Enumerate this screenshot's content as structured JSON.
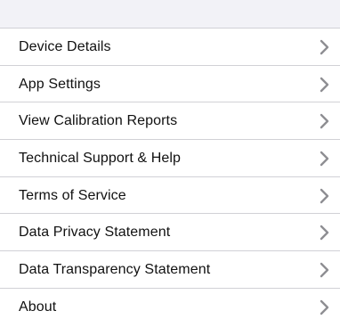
{
  "menu": {
    "items": [
      {
        "label": "Device Details",
        "icon": "chevron-right-icon"
      },
      {
        "label": "App Settings",
        "icon": "chevron-right-icon"
      },
      {
        "label": "View Calibration Reports",
        "icon": "chevron-right-icon"
      },
      {
        "label": "Technical Support & Help",
        "icon": "chevron-right-icon"
      },
      {
        "label": "Terms of Service",
        "icon": "chevron-right-icon"
      },
      {
        "label": "Data Privacy Statement",
        "icon": "chevron-right-icon"
      },
      {
        "label": "Data Transparency Statement",
        "icon": "chevron-right-icon"
      },
      {
        "label": "About",
        "icon": "chevron-right-icon"
      }
    ]
  },
  "colors": {
    "header_background": "#f2f2f7",
    "separator": "#d1d1d6",
    "text": "#111111",
    "chevron": "#8e8e93"
  }
}
